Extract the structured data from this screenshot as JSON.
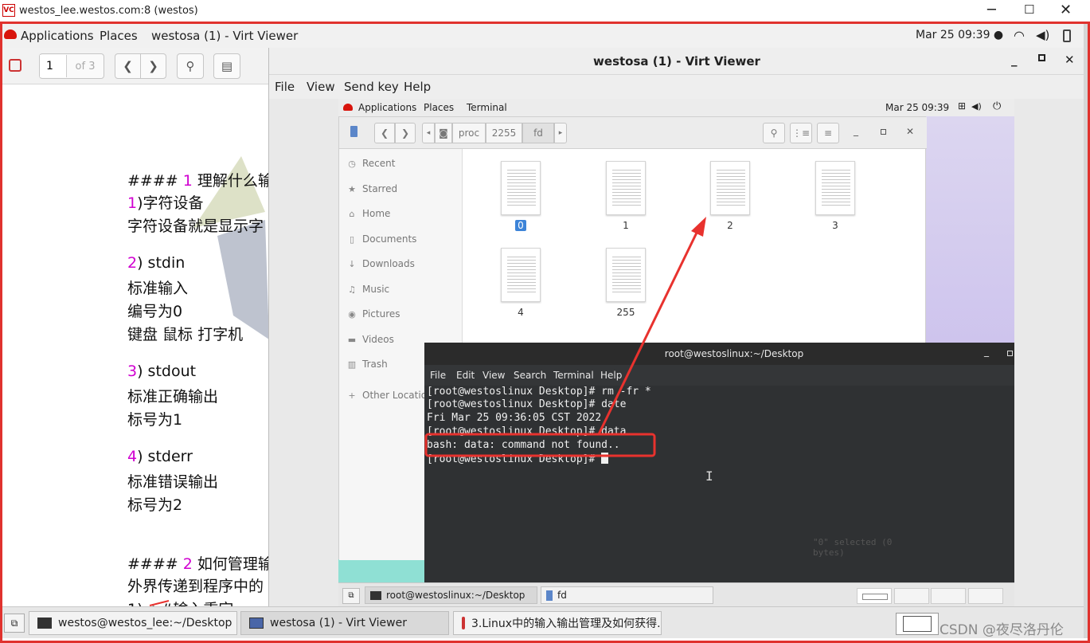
{
  "outer_window": {
    "title": "westos_lee.westos.com:8 (westos)",
    "app_icon": "VC"
  },
  "host_topbar": {
    "applications": "Applications",
    "places": "Places",
    "window_title": "westosa (1) - Virt Viewer",
    "clock": "Mar 25  09:39 ●"
  },
  "doc_viewer": {
    "page_input": "1",
    "page_of": "of 3",
    "lines": {
      "l1_a": "####",
      "l1_num": "1",
      "l1_b": " 理解什么输",
      "l2_num": "1",
      "l2_b": ")字符设备",
      "l3": "字符设备就是显示字",
      "l4_num": "2",
      "l4_b": ") stdin",
      "l5": "标准输入",
      "l6": "编号为0",
      "l7": "键盘 鼠标 打字机",
      "l8_num": "3",
      "l8_b": ") stdout",
      "l9": "标准正确输出",
      "l10": "标号为1",
      "l11_num": "4",
      "l11_b": ") stderr",
      "l12": "标准错误输出",
      "l13": "标号为2",
      "l14_a": "####",
      "l14_num": "2",
      "l14_b": " 如何管理输",
      "l15": "外界传递到程序中的",
      "l16": "1)<  #输入重定"
    }
  },
  "virt_viewer": {
    "title": "westosa (1) - Virt Viewer",
    "menu": [
      "File",
      "View",
      "Send key",
      "Help"
    ]
  },
  "guest_topbar": {
    "applications": "Applications",
    "places": "Places",
    "terminal": "Terminal",
    "clock": "Mar 25  09:39"
  },
  "file_manager": {
    "path": [
      "proc",
      "2255",
      "fd"
    ],
    "sidebar": [
      "Recent",
      "Starred",
      "Home",
      "Documents",
      "Downloads",
      "Music",
      "Pictures",
      "Videos",
      "Trash",
      "Other Locations"
    ],
    "files": [
      "0",
      "1",
      "2",
      "3",
      "4",
      "255"
    ],
    "status": "\"0\" selected (0 bytes)"
  },
  "terminal": {
    "title": "root@westoslinux:~/Desktop",
    "menu": [
      "File",
      "Edit",
      "View",
      "Search",
      "Terminal",
      "Help"
    ],
    "lines": [
      "[root@westoslinux Desktop]# rm -fr *",
      "[root@westoslinux Desktop]# date",
      "Fri Mar 25 09:36:05 CST 2022",
      "[root@westoslinux Desktop]# data",
      "bash: data: command not found..",
      "[root@westoslinux Desktop]# "
    ]
  },
  "guest_taskbar": {
    "tasks": [
      "root@westoslinux:~/Desktop",
      "fd"
    ]
  },
  "host_taskbar": {
    "tasks": [
      "westos@westos_lee:~/Desktop",
      "westosa (1) - Virt Viewer",
      "3.Linux中的输入输出管理及如何获得..."
    ]
  },
  "watermark": "CSDN @夜尽洛丹伦",
  "colors": {
    "annotation_red": "#e8322e",
    "selection_blue": "#3d84d8",
    "markdown_magenta": "#d000d0"
  }
}
